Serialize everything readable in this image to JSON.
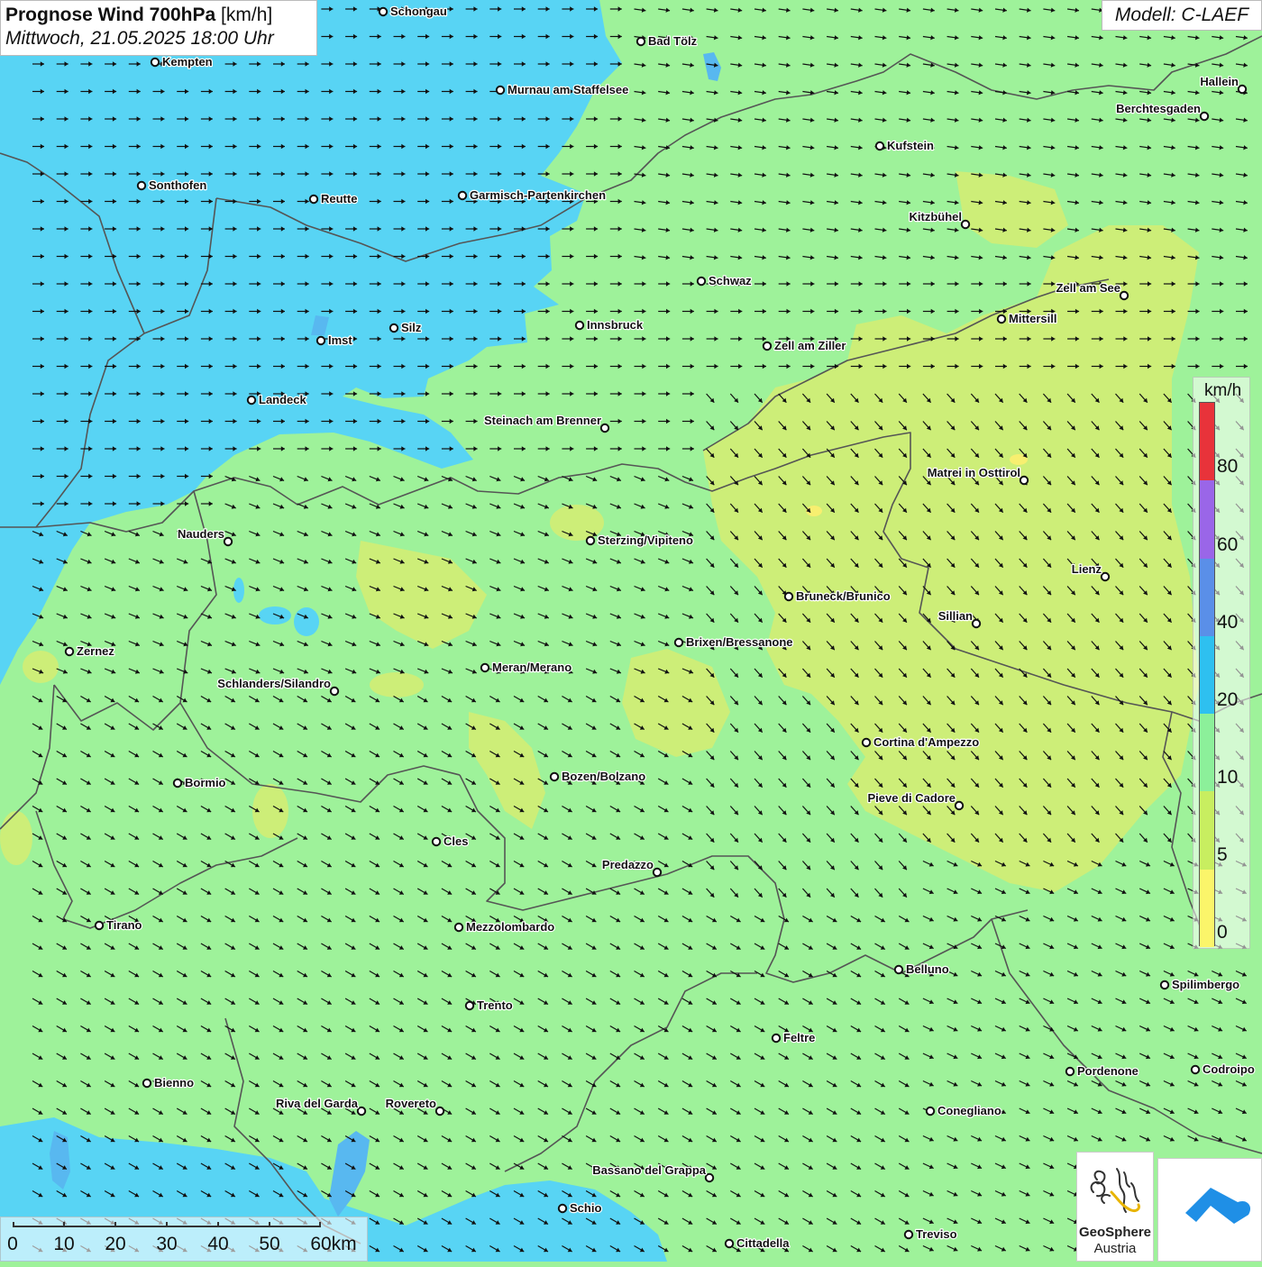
{
  "title": {
    "main": "Prognose Wind 700hPa",
    "unit": "[km/h]",
    "datetime": "Mittwoch, 21.05.2025 18:00 Uhr"
  },
  "model": "Modell: C-LAEF",
  "legend": {
    "unit": "km/h",
    "ticks": [
      "80",
      "60",
      "40",
      "20",
      "10",
      "5",
      "0"
    ],
    "colors": [
      "#e8333a",
      "#9a66e8",
      "#5a8fe8",
      "#2ec0f0",
      "#8cf09a",
      "#c8ee60",
      "#fbf56a"
    ]
  },
  "scalebar": {
    "labels": [
      "0",
      "10",
      "20",
      "30",
      "40",
      "50",
      "60km"
    ]
  },
  "logos": {
    "geosphere_line1": "GeoSphere",
    "geosphere_line2": "Austria",
    "app_icon": "weather-app-icon"
  },
  "wind": {
    "general_direction": "west-northwest",
    "arrow_color": "#111111"
  },
  "cities": [
    {
      "name": "Schongau",
      "label_side": "right"
    },
    {
      "name": "Bad Tölz",
      "label_side": "right"
    },
    {
      "name": "Kempten",
      "label_side": "right"
    },
    {
      "name": "Murnau am Staffelsee",
      "label_side": "right"
    },
    {
      "name": "Hallein",
      "label_side": "left"
    },
    {
      "name": "Berchtesgaden",
      "label_side": "left"
    },
    {
      "name": "Kufstein",
      "label_side": "right"
    },
    {
      "name": "Sonthofen",
      "label_side": "right"
    },
    {
      "name": "Reutte",
      "label_side": "right"
    },
    {
      "name": "Garmisch-Partenkirchen",
      "label_side": "right"
    },
    {
      "name": "Kitzbühel",
      "label_side": "left"
    },
    {
      "name": "Schwaz",
      "label_side": "right"
    },
    {
      "name": "Zell am See",
      "label_side": "left"
    },
    {
      "name": "Mittersill",
      "label_side": "right"
    },
    {
      "name": "Innsbruck",
      "label_side": "right"
    },
    {
      "name": "Silz",
      "label_side": "right"
    },
    {
      "name": "Imst",
      "label_side": "right"
    },
    {
      "name": "Zell am Ziller",
      "label_side": "right"
    },
    {
      "name": "Landeck",
      "label_side": "right"
    },
    {
      "name": "Steinach am Brenner",
      "label_side": "left"
    },
    {
      "name": "Matrei in Osttirol",
      "label_side": "left"
    },
    {
      "name": "Nauders",
      "label_side": "left"
    },
    {
      "name": "Sterzing/Vipiteno",
      "label_side": "right"
    },
    {
      "name": "Lienz",
      "label_side": "left"
    },
    {
      "name": "Bruneck/Brunico",
      "label_side": "right"
    },
    {
      "name": "Sillian",
      "label_side": "left"
    },
    {
      "name": "Brixen/Bressanone",
      "label_side": "right"
    },
    {
      "name": "Zernez",
      "label_side": "right"
    },
    {
      "name": "Meran/Merano",
      "label_side": "right"
    },
    {
      "name": "Schlanders/Silandro",
      "label_side": "left"
    },
    {
      "name": "Cortina d'Ampezzo",
      "label_side": "right"
    },
    {
      "name": "Bozen/Bolzano",
      "label_side": "right"
    },
    {
      "name": "Bormio",
      "label_side": "right"
    },
    {
      "name": "Pieve di Cadore",
      "label_side": "left"
    },
    {
      "name": "Cles",
      "label_side": "right"
    },
    {
      "name": "Predazzo",
      "label_side": "left"
    },
    {
      "name": "Tirano",
      "label_side": "right"
    },
    {
      "name": "Mezzolombardo",
      "label_side": "right"
    },
    {
      "name": "Belluno",
      "label_side": "right"
    },
    {
      "name": "Spilimbergo",
      "label_side": "right"
    },
    {
      "name": "Trento",
      "label_side": "right"
    },
    {
      "name": "Feltre",
      "label_side": "right"
    },
    {
      "name": "Pordenone",
      "label_side": "right"
    },
    {
      "name": "Codroipo",
      "label_side": "right"
    },
    {
      "name": "Bienno",
      "label_side": "right"
    },
    {
      "name": "Riva del Garda",
      "label_side": "left"
    },
    {
      "name": "Rovereto",
      "label_side": "left"
    },
    {
      "name": "Conegliano",
      "label_side": "right"
    },
    {
      "name": "Bassano del Grappa",
      "label_side": "left"
    },
    {
      "name": "Schio",
      "label_side": "right"
    },
    {
      "name": "Treviso",
      "label_side": "right"
    },
    {
      "name": "Cittadella",
      "label_side": "right"
    }
  ]
}
